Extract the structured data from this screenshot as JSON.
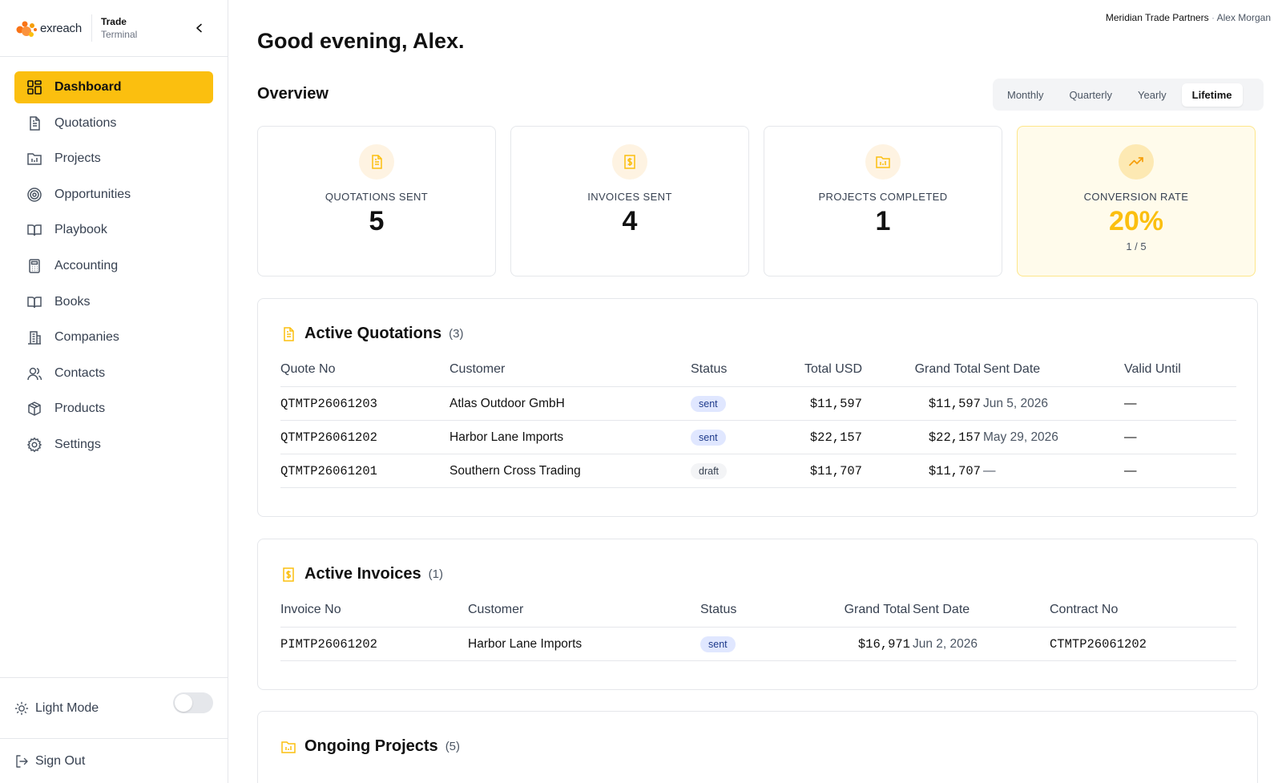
{
  "brand": {
    "wordmark": "exreach",
    "title_line1": "Trade",
    "title_line2": "Terminal",
    "accent_color": "#fbbf0f"
  },
  "sidebar": {
    "items": [
      {
        "label": "Dashboard",
        "icon": "dashboard-grid-icon",
        "active": true
      },
      {
        "label": "Quotations",
        "icon": "document-icon"
      },
      {
        "label": "Projects",
        "icon": "folder-chart-icon"
      },
      {
        "label": "Opportunities",
        "icon": "target-icon"
      },
      {
        "label": "Playbook",
        "icon": "book-open-icon"
      },
      {
        "label": "Accounting",
        "icon": "calculator-icon"
      },
      {
        "label": "Books",
        "icon": "book-open-icon"
      },
      {
        "label": "Companies",
        "icon": "building-icon"
      },
      {
        "label": "Contacts",
        "icon": "users-icon"
      },
      {
        "label": "Products",
        "icon": "box-icon"
      },
      {
        "label": "Settings",
        "icon": "gear-icon"
      }
    ],
    "mode_label": "Light Mode",
    "signout_label": "Sign Out"
  },
  "header": {
    "org": "Meridian Trade Partners",
    "separator": "·",
    "user": "Alex Morgan",
    "greeting": "Good evening, Alex."
  },
  "overview": {
    "title": "Overview",
    "periods": [
      "Monthly",
      "Quarterly",
      "Yearly",
      "Lifetime"
    ],
    "selected_period": "Lifetime",
    "cards": [
      {
        "label": "QUOTATIONS SENT",
        "value": "5",
        "icon": "document-icon"
      },
      {
        "label": "INVOICES SENT",
        "value": "4",
        "icon": "invoice-dollar-icon"
      },
      {
        "label": "PROJECTS COMPLETED",
        "value": "1",
        "icon": "folder-chart-icon"
      },
      {
        "label": "CONVERSION RATE",
        "value": "20%",
        "sub": "1 / 5",
        "icon": "trending-up-icon"
      }
    ]
  },
  "quotations": {
    "title": "Active Quotations",
    "count": "(3)",
    "columns": [
      "Quote No",
      "Customer",
      "Status",
      "Total USD",
      "Grand Total",
      "Sent Date",
      "Valid Until"
    ],
    "rows": [
      {
        "no": "QTMTP26061203",
        "customer": "Atlas Outdoor GmbH",
        "status": "sent",
        "total": "$11,597",
        "grand": "$11,597",
        "sent": "Jun 5, 2026",
        "valid": "—"
      },
      {
        "no": "QTMTP26061202",
        "customer": "Harbor Lane Imports",
        "status": "sent",
        "total": "$22,157",
        "grand": "$22,157",
        "sent": "May 29, 2026",
        "valid": "—"
      },
      {
        "no": "QTMTP26061201",
        "customer": "Southern Cross Trading",
        "status": "draft",
        "total": "$11,707",
        "grand": "$11,707",
        "sent": "—",
        "valid": "—"
      }
    ]
  },
  "invoices": {
    "title": "Active Invoices",
    "count": "(1)",
    "columns": [
      "Invoice No",
      "Customer",
      "Status",
      "Grand Total",
      "Sent Date",
      "Contract No"
    ],
    "rows": [
      {
        "no": "PIMTP26061202",
        "customer": "Harbor Lane Imports",
        "status": "sent",
        "grand": "$16,971",
        "sent": "Jun 2, 2026",
        "contract": "CTMTP26061202"
      }
    ]
  },
  "projects": {
    "title": "Ongoing Projects",
    "count": "(5)"
  }
}
